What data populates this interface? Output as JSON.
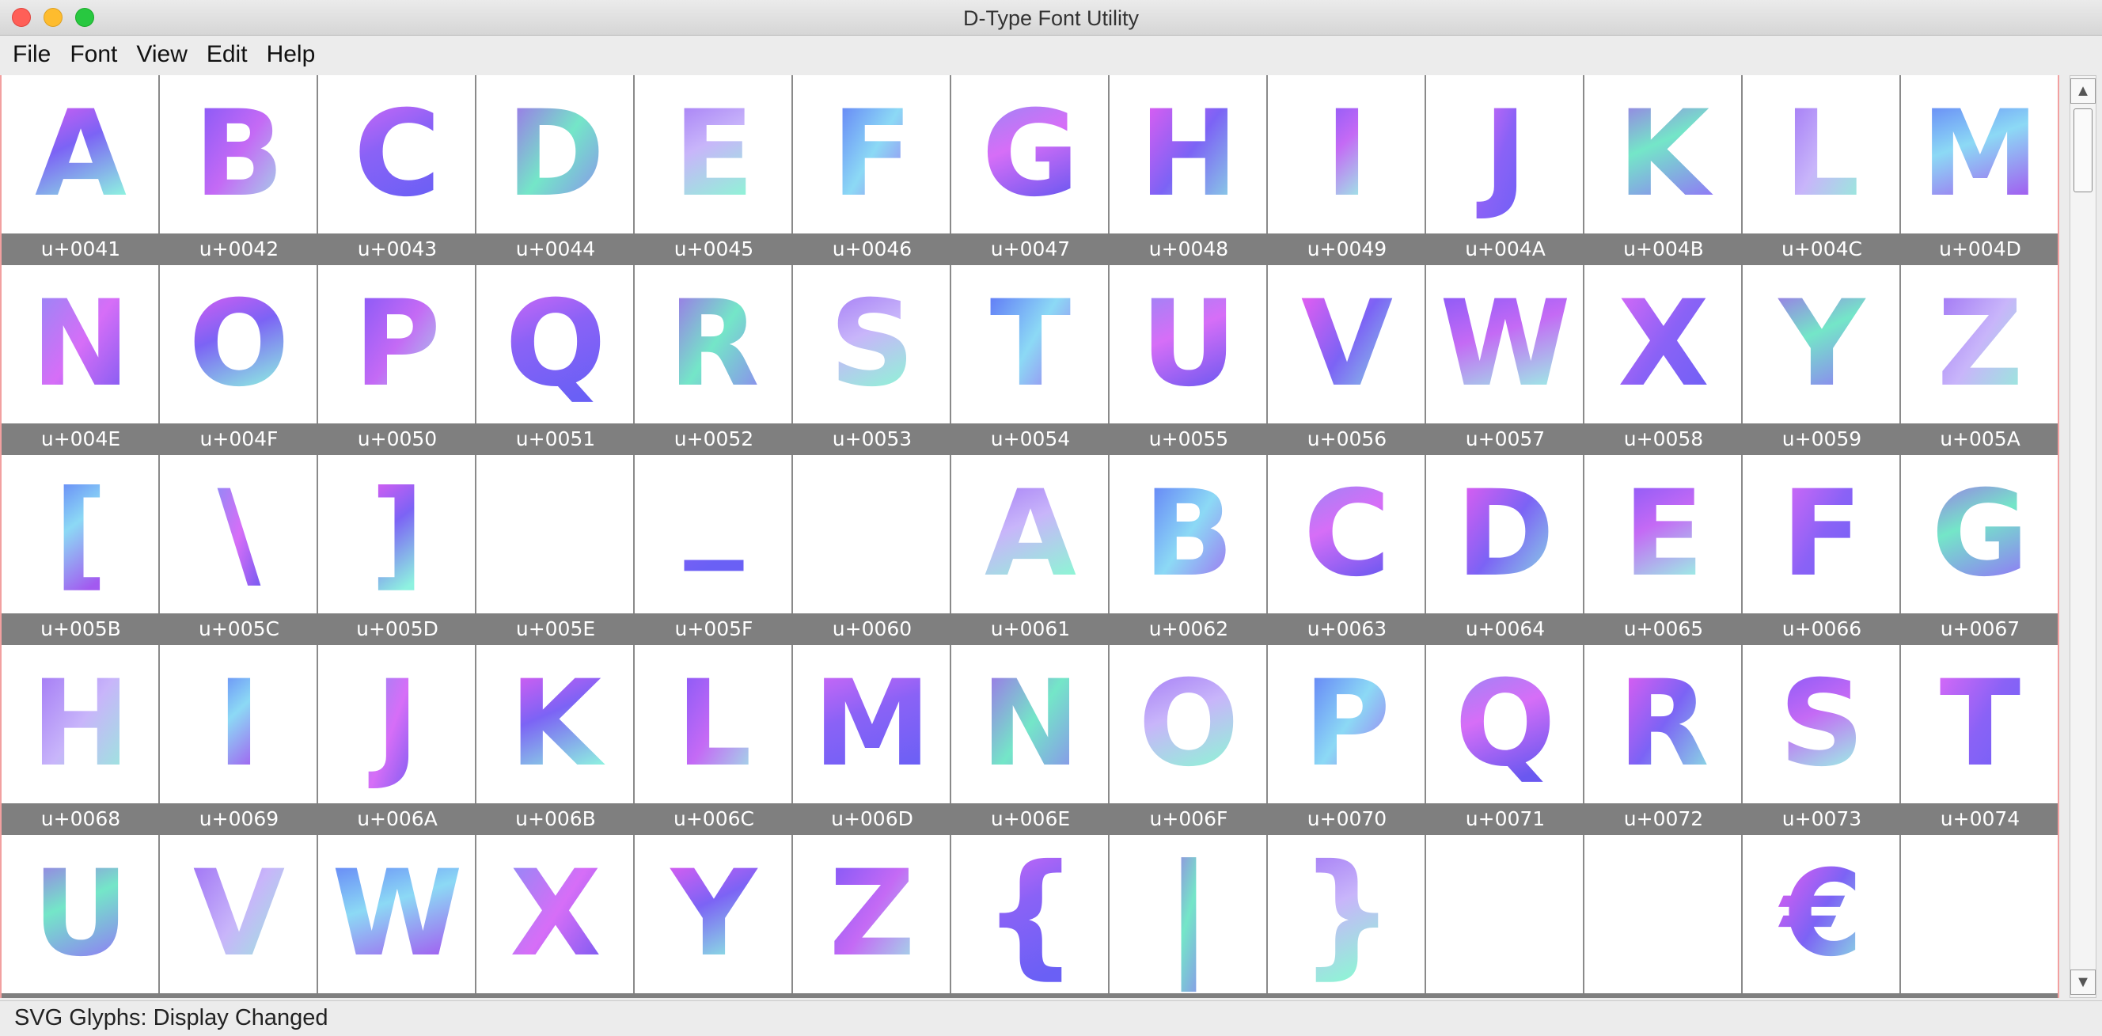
{
  "window": {
    "title": "D-Type Font Utility"
  },
  "menu": [
    "File",
    "Font",
    "View",
    "Edit",
    "Help"
  ],
  "status": {
    "text": "SVG Glyphs: Display Changed"
  },
  "scrollbar": {
    "up_arrow": "▲",
    "down_arrow": "▼"
  },
  "glyphs": [
    {
      "code": "u+0041",
      "char": "A"
    },
    {
      "code": "u+0042",
      "char": "B"
    },
    {
      "code": "u+0043",
      "char": "C"
    },
    {
      "code": "u+0044",
      "char": "D"
    },
    {
      "code": "u+0045",
      "char": "E"
    },
    {
      "code": "u+0046",
      "char": "F"
    },
    {
      "code": "u+0047",
      "char": "G"
    },
    {
      "code": "u+0048",
      "char": "H"
    },
    {
      "code": "u+0049",
      "char": "I"
    },
    {
      "code": "u+004A",
      "char": "J"
    },
    {
      "code": "u+004B",
      "char": "K"
    },
    {
      "code": "u+004C",
      "char": "L"
    },
    {
      "code": "u+004D",
      "char": "M"
    },
    {
      "code": "u+004E",
      "char": "N"
    },
    {
      "code": "u+004F",
      "char": "O"
    },
    {
      "code": "u+0050",
      "char": "P"
    },
    {
      "code": "u+0051",
      "char": "Q"
    },
    {
      "code": "u+0052",
      "char": "R"
    },
    {
      "code": "u+0053",
      "char": "S"
    },
    {
      "code": "u+0054",
      "char": "T"
    },
    {
      "code": "u+0055",
      "char": "U"
    },
    {
      "code": "u+0056",
      "char": "V"
    },
    {
      "code": "u+0057",
      "char": "W"
    },
    {
      "code": "u+0058",
      "char": "X"
    },
    {
      "code": "u+0059",
      "char": "Y"
    },
    {
      "code": "u+005A",
      "char": "Z"
    },
    {
      "code": "u+005B",
      "char": "["
    },
    {
      "code": "u+005C",
      "char": "\\"
    },
    {
      "code": "u+005D",
      "char": "]"
    },
    {
      "code": "u+005E",
      "char": ""
    },
    {
      "code": "u+005F",
      "char": "_"
    },
    {
      "code": "u+0060",
      "char": ""
    },
    {
      "code": "u+0061",
      "char": "A"
    },
    {
      "code": "u+0062",
      "char": "B"
    },
    {
      "code": "u+0063",
      "char": "C"
    },
    {
      "code": "u+0064",
      "char": "D"
    },
    {
      "code": "u+0065",
      "char": "E"
    },
    {
      "code": "u+0066",
      "char": "F"
    },
    {
      "code": "u+0067",
      "char": "G"
    },
    {
      "code": "u+0068",
      "char": "H"
    },
    {
      "code": "u+0069",
      "char": "I"
    },
    {
      "code": "u+006A",
      "char": "J"
    },
    {
      "code": "u+006B",
      "char": "K"
    },
    {
      "code": "u+006C",
      "char": "L"
    },
    {
      "code": "u+006D",
      "char": "M"
    },
    {
      "code": "u+006E",
      "char": "N"
    },
    {
      "code": "u+006F",
      "char": "O"
    },
    {
      "code": "u+0070",
      "char": "P"
    },
    {
      "code": "u+0071",
      "char": "Q"
    },
    {
      "code": "u+0072",
      "char": "R"
    },
    {
      "code": "u+0073",
      "char": "S"
    },
    {
      "code": "u+0074",
      "char": "T"
    },
    {
      "code": "",
      "char": "U"
    },
    {
      "code": "",
      "char": "V"
    },
    {
      "code": "",
      "char": "W"
    },
    {
      "code": "",
      "char": "X"
    },
    {
      "code": "",
      "char": "Y"
    },
    {
      "code": "",
      "char": "Z"
    },
    {
      "code": "",
      "char": "{"
    },
    {
      "code": "",
      "char": "|"
    },
    {
      "code": "",
      "char": "}"
    },
    {
      "code": "",
      "char": ""
    },
    {
      "code": "",
      "char": ""
    },
    {
      "code": "",
      "char": "€"
    },
    {
      "code": "",
      "char": ""
    }
  ],
  "palette": {
    "gradients": [
      [
        "#f55cf0",
        "#7c63f5",
        "#8ef2e0"
      ],
      [
        "#7a56f7",
        "#c46af5",
        "#9cf0e5"
      ],
      [
        "#e06af7",
        "#8a62f6",
        "#6a60f5"
      ],
      [
        "#a65af0",
        "#74e6c8",
        "#8f7cf5"
      ],
      [
        "#9b6cf4",
        "#c8b5fa",
        "#8ef5d5"
      ],
      [
        "#5a6cf7",
        "#8cd9f5",
        "#a25af0"
      ],
      [
        "#8a8cf5",
        "#d66ef7",
        "#6a58f0"
      ]
    ]
  }
}
